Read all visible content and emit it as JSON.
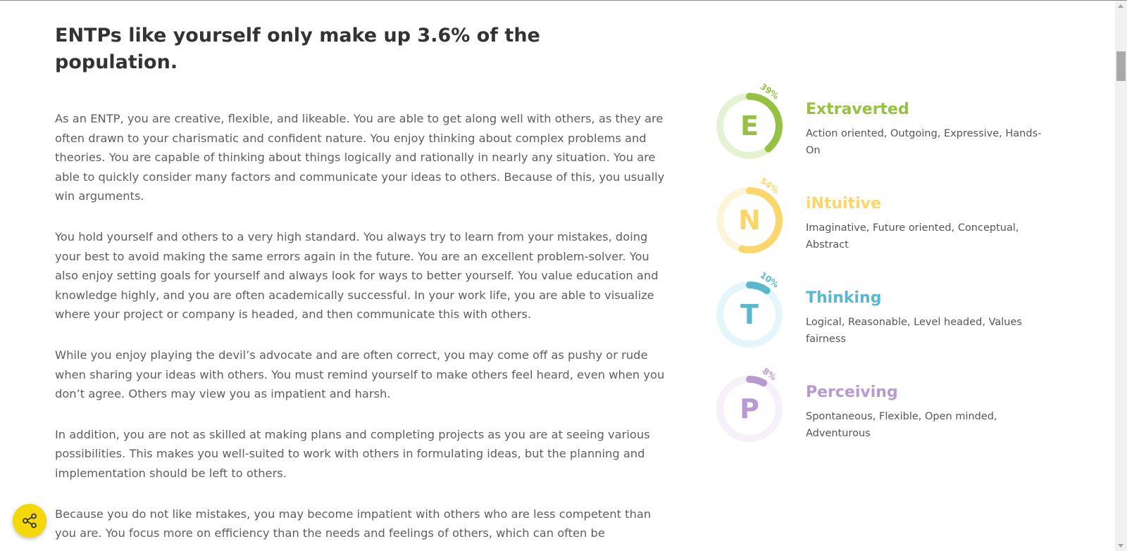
{
  "headline": "ENTPs like yourself only make up 3.6% of the population.",
  "paragraphs": [
    "As an ENTP, you are creative, flexible, and likeable. You are able to get along well with others, as they are often drawn to your charismatic and confident nature. You enjoy thinking about complex problems and theories. You are capable of thinking about things logically and rationally in nearly any situation. You are able to quickly consider many factors and communicate your ideas to others. Because of this, you usually win arguments.",
    "You hold yourself and others to a very high standard. You always try to learn from your mistakes, doing your best to avoid making the same errors again in the future. You are an excellent problem-solver. You also enjoy setting goals for yourself and always look for ways to better yourself. You value education and knowledge highly, and you are often academically successful. In your work life, you are able to visualize where your project or company is headed, and then communicate this with others.",
    "While you enjoy playing the devil’s advocate and are often correct, you may come off as pushy or rude when sharing your ideas with others. You must remind yourself to make others feel heard, even when you don’t agree. Others may view you as impatient and harsh.",
    "In addition, you are not as skilled at making plans and completing projects as you are at seeing various possibilities. This makes you well-suited to work with others in formulating ideas, but the planning and implementation should be left to others.",
    "Because you do not like mistakes, you may become impatient with others who are less competent than you are. You focus more on efficiency than the needs and feelings of others, which can often be"
  ],
  "traits": [
    {
      "letter": "E",
      "name": "Extraverted",
      "percent": 39,
      "percent_label": "39%",
      "description": "Action oriented, Outgoing, Expressive, Hands-On",
      "color": "#96c243",
      "track_color": "#e6f2d4"
    },
    {
      "letter": "N",
      "name": "iNtuitive",
      "percent": 54,
      "percent_label": "54%",
      "description": "Imaginative, Future oriented, Conceptual, Abstract",
      "color": "#fbd66a",
      "track_color": "#fef5d9"
    },
    {
      "letter": "T",
      "name": "Thinking",
      "percent": 10,
      "percent_label": "10%",
      "description": "Logical, Reasonable, Level headed, Values fairness",
      "color": "#5ab8ce",
      "track_color": "#e4f6fb"
    },
    {
      "letter": "P",
      "name": "Perceiving",
      "percent": 8,
      "percent_label": "8%",
      "description": "Spontaneous, Flexible, Open minded, Adventurous",
      "color": "#b79ad0",
      "track_color": "#f6f0fa"
    }
  ],
  "share": {
    "icon": "share-icon",
    "color": "#f5d80a"
  }
}
